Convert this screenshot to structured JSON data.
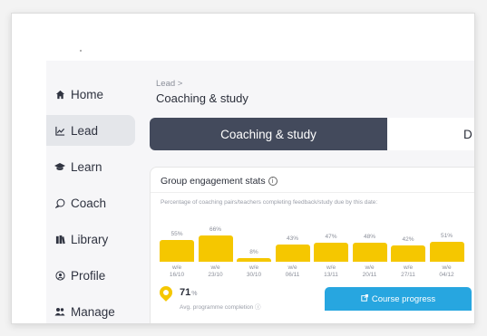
{
  "sidebar": {
    "items": [
      {
        "label": "Home",
        "icon": "home-icon",
        "glyph": "🏠"
      },
      {
        "label": "Lead",
        "icon": "chart-icon",
        "glyph": "📈"
      },
      {
        "label": "Learn",
        "icon": "graduation-cap-icon",
        "glyph": "🎓"
      },
      {
        "label": "Coach",
        "icon": "chat-bubble-icon",
        "glyph": "◯"
      },
      {
        "label": "Library",
        "icon": "books-icon",
        "glyph": "📚"
      },
      {
        "label": "Profile",
        "icon": "user-circle-icon",
        "glyph": "◎"
      },
      {
        "label": "Manage",
        "icon": "users-icon",
        "glyph": "👥"
      }
    ],
    "active_index": 1
  },
  "header": {
    "breadcrumb": "Lead >",
    "title": "Coaching & study"
  },
  "tabs": [
    {
      "label": "Coaching & study",
      "active": true
    },
    {
      "label": "D",
      "active": false
    }
  ],
  "card": {
    "title": "Group engagement stats",
    "subtitle": "Percentage of coaching pairs/teachers completing feedback/study due by this date:",
    "avg_value": "71",
    "avg_unit": "%",
    "avg_label": "Avg. programme completion ⓘ",
    "button_label": "Course progress"
  },
  "chart_data": {
    "type": "bar",
    "categories": [
      "w/e 16/10",
      "w/e 23/10",
      "w/e 30/10",
      "w/e 06/11",
      "w/e 13/11",
      "w/e 20/11",
      "w/e 27/11",
      "w/e 04/12"
    ],
    "values": [
      55,
      66,
      8,
      43,
      47,
      48,
      42,
      51
    ],
    "value_labels": [
      "55%",
      "66%",
      "8%",
      "43%",
      "47%",
      "48%",
      "42%",
      "51%"
    ],
    "bar_color": "#f5c700",
    "ylim": [
      0,
      100
    ]
  },
  "colors": {
    "tab_active": "#434a5c",
    "bar": "#f5c700",
    "button": "#27a6e0",
    "sidebar_active": "#e4e6ea"
  }
}
